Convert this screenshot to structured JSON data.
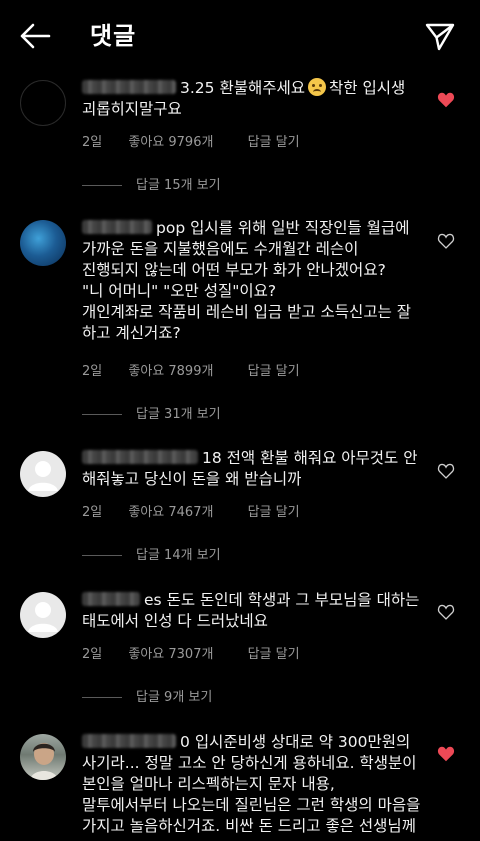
{
  "header": {
    "title": "댓글",
    "back_icon": "arrow-left-icon",
    "send_icon": "paper-plane-icon"
  },
  "comments": [
    {
      "username_suffix": "3.25",
      "text_before_emoji": "환불해주세요",
      "text_after_emoji": "착한 입시생\n괴롭히지말구요",
      "time": "2일",
      "likes": "좋아요 9796개",
      "reply": "답글 달기",
      "view_replies": "답글 15개 보기",
      "liked": true
    },
    {
      "username_suffix": "pop",
      "text": "입시를 위해 일반 직장인들 월급에\n가까운 돈을 지불했음에도 수개월간 레슨이\n진행되지 않는데 어떤 부모가 화가 안나겠어요?\n\"니 어머니\" \"오만 성질\"이요?\n개인계좌로 작품비 레슨비 입금 받고 소득신고는 잘\n하고 계신거죠?",
      "time": "2일",
      "likes": "좋아요 7899개",
      "reply": "답글 달기",
      "view_replies": "답글 31개 보기",
      "liked": false
    },
    {
      "username_suffix": "18",
      "text": "전액 환불 해줘요 아무것도 안\n해줘놓고 당신이 돈을 왜 받습니까",
      "time": "2일",
      "likes": "좋아요 7467개",
      "reply": "답글 달기",
      "view_replies": "답글 14개 보기",
      "liked": false
    },
    {
      "username_suffix": "es",
      "text": "돈도 돈인데 학생과 그 부모님을 대하는\n태도에서 인성 다 드러났네요",
      "time": "2일",
      "likes": "좋아요 7307개",
      "reply": "답글 달기",
      "view_replies": "답글 9개 보기",
      "liked": false
    },
    {
      "username_suffix": "0",
      "text": "입시준비생 상대로 약 300만원의\n사기라... 정말 고소 안 당하신게 용하네요. 학생분이\n본인을 얼마나 리스펙하는지 문자 내용,\n말투에서부터 나오는데 질린님은 그런 학생의 마음을\n가지고 놀음하신거죠. 비싼 돈 드리고 좋은 선생님께",
      "liked": true
    }
  ],
  "colors": {
    "background": "#000000",
    "text": "#f2f2f2",
    "meta": "#9a9a9a",
    "like_active": "#ed4956"
  }
}
